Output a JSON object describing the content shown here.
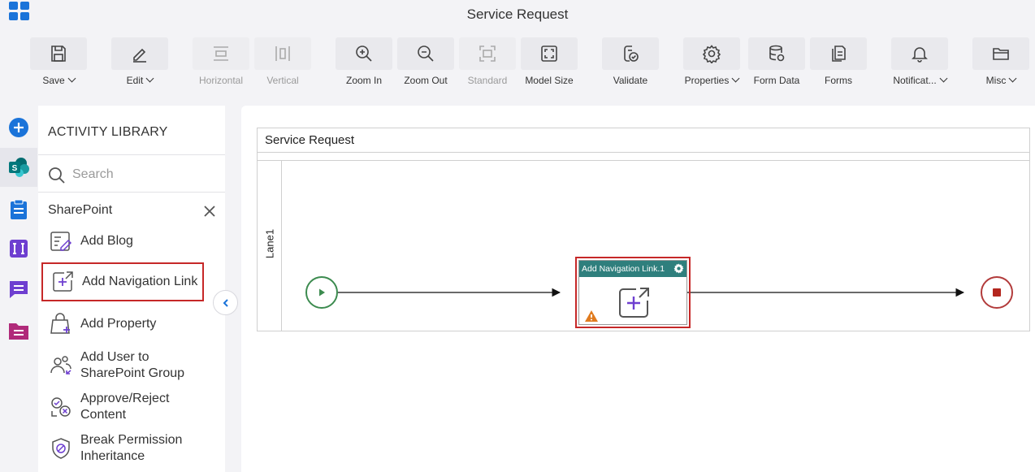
{
  "app": {
    "title": "Service Request"
  },
  "toolbar": {
    "save": "Save",
    "edit": "Edit",
    "horizontal": "Horizontal",
    "vertical": "Vertical",
    "zoom_in": "Zoom In",
    "zoom_out": "Zoom Out",
    "standard": "Standard",
    "model_size": "Model Size",
    "validate": "Validate",
    "properties": "Properties",
    "form_data": "Form Data",
    "forms": "Forms",
    "notifications": "Notificat...",
    "misc": "Misc"
  },
  "library": {
    "title": "ACTIVITY LIBRARY",
    "search_placeholder": "Search",
    "category": "SharePoint",
    "items": [
      {
        "line1": "Add Blog",
        "line2": "",
        "icon": "add-blog-icon"
      },
      {
        "line1": "Add Navigation Link",
        "line2": "",
        "icon": "add-navigation-link-icon"
      },
      {
        "line1": "Add Property",
        "line2": "",
        "icon": "add-property-icon"
      },
      {
        "line1": "Add User to",
        "line2": "SharePoint Group",
        "icon": "add-user-icon"
      },
      {
        "line1": "Approve/Reject",
        "line2": "Content",
        "icon": "approve-reject-icon"
      },
      {
        "line1": "Break Permission",
        "line2": "Inheritance",
        "icon": "break-permission-icon"
      }
    ]
  },
  "canvas": {
    "pool_title": "Service Request",
    "lane_label": "Lane1",
    "task_title": "Add Navigation Link.1"
  },
  "colors": {
    "accent": "#1a73d9",
    "selection": "#c62828",
    "task_header": "#2f7f7d",
    "start_event": "#3c8b4f",
    "end_event": "#b23b3b",
    "icon_purple": "#6e3fd0"
  }
}
